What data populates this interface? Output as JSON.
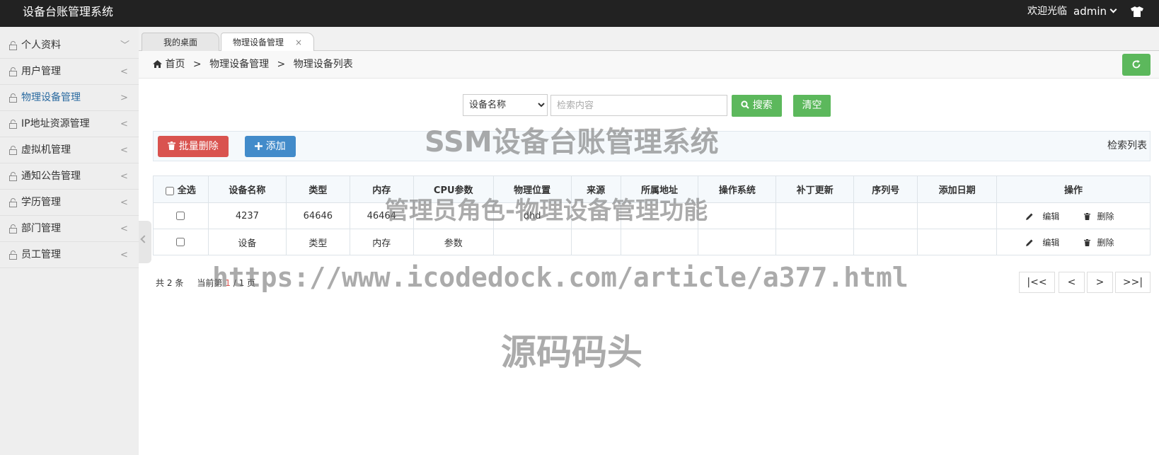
{
  "app": {
    "title": "设备台账管理系统",
    "welcome": "欢迎光临",
    "user": "admin"
  },
  "sidebar": {
    "items": [
      {
        "label": "个人资料",
        "arrow": "﹀"
      },
      {
        "label": "用户管理",
        "arrow": "<"
      },
      {
        "label": "物理设备管理",
        "arrow": ">"
      },
      {
        "label": "IP地址资源管理",
        "arrow": "<"
      },
      {
        "label": "虚拟机管理",
        "arrow": "<"
      },
      {
        "label": "通知公告管理",
        "arrow": "<"
      },
      {
        "label": "学历管理",
        "arrow": "<"
      },
      {
        "label": "部门管理",
        "arrow": "<"
      },
      {
        "label": "员工管理",
        "arrow": "<"
      }
    ]
  },
  "tabs": [
    {
      "label": "我的桌面"
    },
    {
      "label": "物理设备管理",
      "close": "×"
    }
  ],
  "breadcrumb": {
    "home": "首页",
    "level1": "物理设备管理",
    "level2": "物理设备列表",
    "sep": ">"
  },
  "search": {
    "field": "设备名称",
    "placeholder": "检索内容",
    "search_label": "搜索",
    "clear_label": "清空"
  },
  "toolbar": {
    "batch_delete_label": "批量删除",
    "add_label": "添加",
    "title": "检索列表"
  },
  "table": {
    "headers": {
      "select_all": "全选",
      "name": "设备名称",
      "type": "类型",
      "memory": "内存",
      "cpu": "CPU参数",
      "location": "物理位置",
      "source": "来源",
      "address": "所属地址",
      "os": "操作系统",
      "patch": "补丁更新",
      "serial": "序列号",
      "date": "添加日期",
      "ops": "操作"
    },
    "rows": [
      {
        "name": "4237",
        "type": "64646",
        "memory": "46464",
        "cpu": "",
        "location": "dhd",
        "source": "",
        "address": "",
        "os": "",
        "patch": "",
        "serial": "",
        "date": "",
        "edit": "编辑",
        "delete": "删除"
      },
      {
        "name": "设备",
        "type": "类型",
        "memory": "内存",
        "cpu": "参数",
        "location": "",
        "source": "",
        "address": "",
        "os": "",
        "patch": "",
        "serial": "",
        "date": "",
        "edit": "编辑",
        "delete": "删除"
      }
    ]
  },
  "pagination": {
    "total_prefix": "共",
    "total": "2",
    "total_suffix": "条",
    "current_prefix": "当前第",
    "current": "1",
    "pages": "/ 1 页",
    "first": "|<<",
    "prev": "<",
    "next": ">",
    "last": ">>|"
  },
  "watermarks": {
    "line1": "SSM设备台账管理系统",
    "line2": "管理员角色-物理设备管理功能",
    "line3": "https://www.icodedock.com/article/a377.html",
    "line4": "源码码头"
  },
  "colors": {
    "topbar": "#222222",
    "success": "#5cb85c",
    "danger": "#d9534f",
    "primary": "#428bca",
    "active_menu": "#2a6aa0"
  }
}
